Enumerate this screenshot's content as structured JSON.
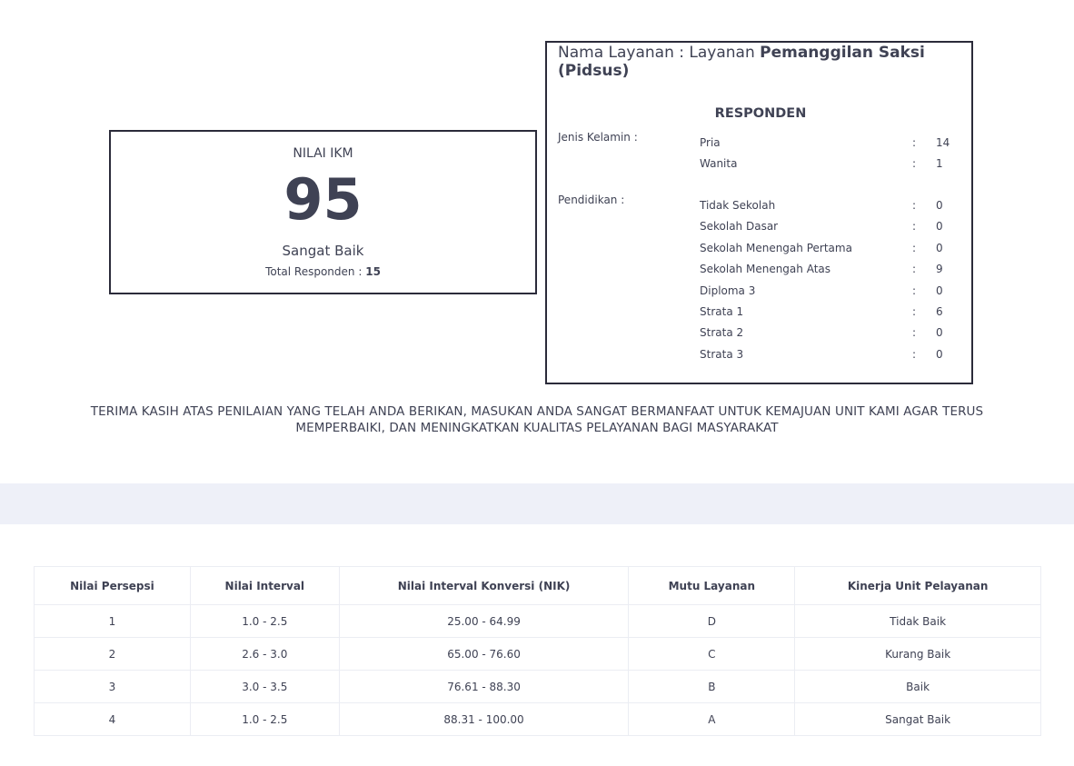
{
  "ikm": {
    "title": "NILAI IKM",
    "value": "95",
    "quality": "Sangat Baik",
    "total_label": "Total Responden :",
    "total_value": "15"
  },
  "service": {
    "prefix": "Nama Layanan : Layanan",
    "name": "Pemanggilan Saksi (Pidsus)"
  },
  "responden": {
    "heading": "RESPONDEN",
    "gender_label": "Jenis Kelamin :",
    "gender": [
      {
        "label": "Pria",
        "value": "14"
      },
      {
        "label": "Wanita",
        "value": "1"
      }
    ],
    "education_label": "Pendidikan :",
    "education": [
      {
        "label": "Tidak Sekolah",
        "value": "0"
      },
      {
        "label": "Sekolah Dasar",
        "value": "0"
      },
      {
        "label": "Sekolah Menengah Pertama",
        "value": "0"
      },
      {
        "label": "Sekolah Menengah Atas",
        "value": "9"
      },
      {
        "label": "Diploma 3",
        "value": "0"
      },
      {
        "label": "Strata 1",
        "value": "6"
      },
      {
        "label": "Strata 2",
        "value": "0"
      },
      {
        "label": "Strata 3",
        "value": "0"
      }
    ],
    "colon": ":"
  },
  "thanks": {
    "line1": "TERIMA KASIH ATAS PENILAIAN YANG TELAH ANDA BERIKAN, MASUKAN ANDA SANGAT BERMANFAAT UNTUK KEMAJUAN UNIT KAMI AGAR TERUS",
    "line2": "MEMPERBAIKI, DAN MENINGKATKAN KUALITAS PELAYANAN BAGI MASYARAKAT"
  },
  "table": {
    "headers": [
      "Nilai Persepsi",
      "Nilai Interval",
      "Nilai Interval Konversi (NIK)",
      "Mutu Layanan",
      "Kinerja Unit Pelayanan"
    ],
    "rows": [
      [
        "1",
        "1.0 - 2.5",
        "25.00 - 64.99",
        "D",
        "Tidak Baik"
      ],
      [
        "2",
        "2.6 - 3.0",
        "65.00 - 76.60",
        "C",
        "Kurang Baik"
      ],
      [
        "3",
        "3.0 - 3.5",
        "76.61 - 88.30",
        "B",
        "Baik"
      ],
      [
        "4",
        "1.0 - 2.5",
        "88.31 - 100.00",
        "A",
        "Sangat Baik"
      ]
    ]
  }
}
